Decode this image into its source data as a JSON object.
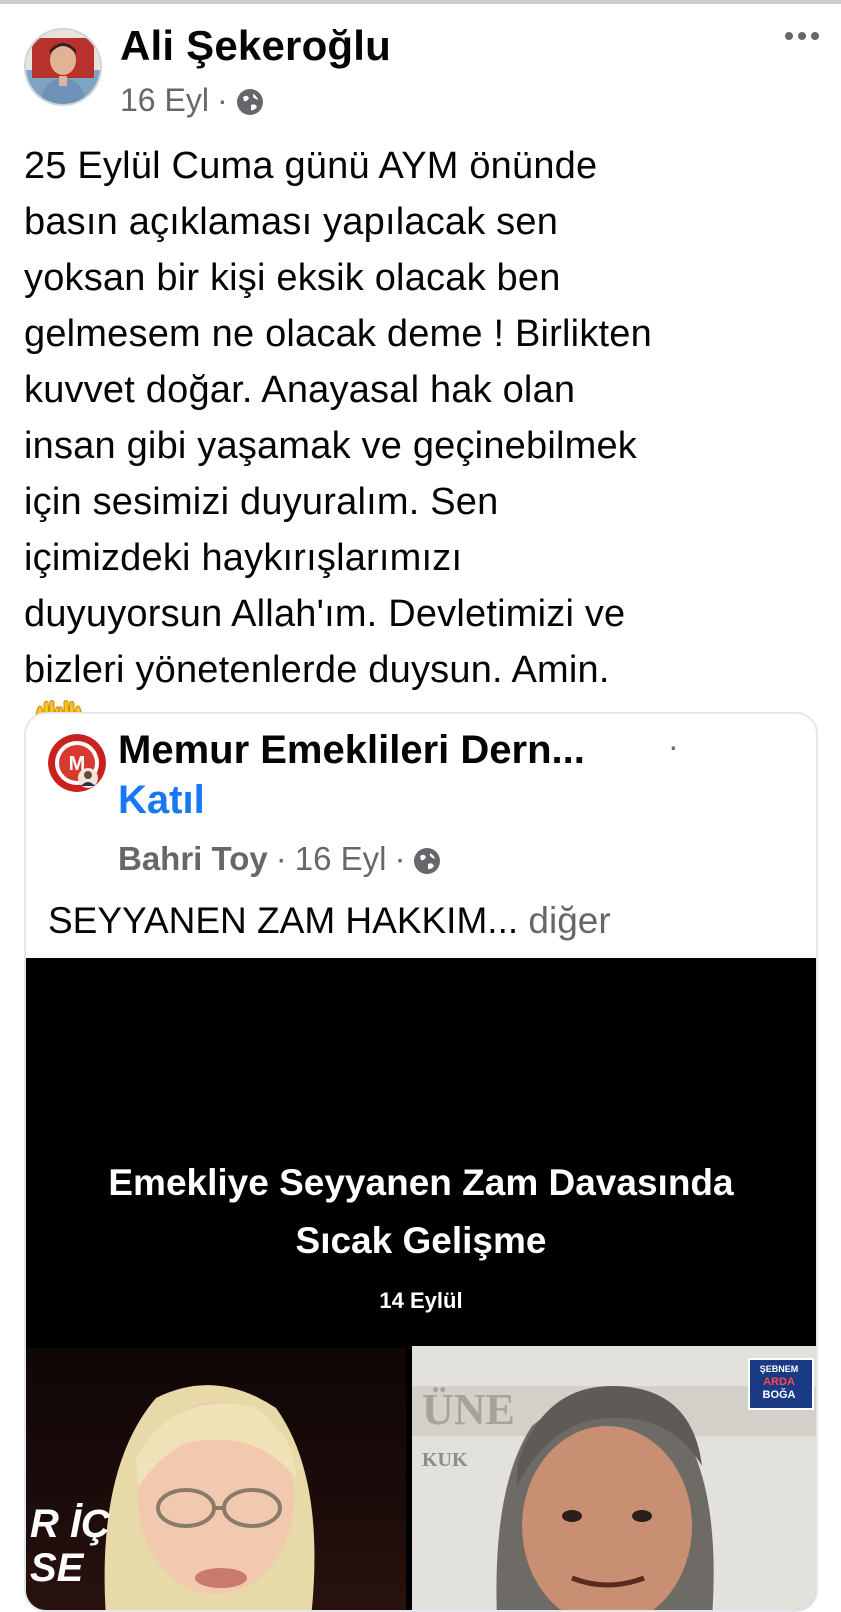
{
  "post": {
    "author": "Ali Şekeroğlu",
    "date": "16 Eyl",
    "separator": "·",
    "text_lines": [
      "25 Eylül Cuma günü AYM önünde",
      "basın açıklaması yapılacak sen",
      "yoksan bir kişi eksik olacak ben",
      "gelmesem ne olacak deme ! Birlikten",
      "kuvvet doğar. Anayasal hak olan",
      "insan gibi yaşamak ve geçinebilmek",
      "için sesimizi duyuralım. Sen",
      "içimizdeki haykırışlarımızı",
      "duyuyorsun Allah'ım. Devletimizi ve",
      "bizleri yönetenlerde duysun. Amin."
    ]
  },
  "shared": {
    "group_name": "Memur Emeklileri Dern...",
    "separator": "·",
    "join_label": "Katıl",
    "author": "Bahri Toy",
    "date": "16 Eyl",
    "text": "SEYYANEN ZAM HAKKIM...",
    "more_label": "diğer"
  },
  "video": {
    "headline_line1": "Emekliye Seyyanen Zam Davasında",
    "headline_line2": "Sıcak Gelişme",
    "date": "14 Eylül",
    "overlay_line1": "R İÇ",
    "overlay_line2": "SE",
    "logo_line1": "ŞEBNEM",
    "logo_line2": "ARDA",
    "logo_line3": "BOĞA",
    "studio_text": "ÜNE",
    "studio_text2": "KUK"
  },
  "colors": {
    "link": "#1877f2",
    "secondary_text": "#65676b",
    "card_border": "#e4e6eb"
  },
  "icons": [
    "globe-icon",
    "more-options-icon",
    "raising-hands-icon"
  ]
}
